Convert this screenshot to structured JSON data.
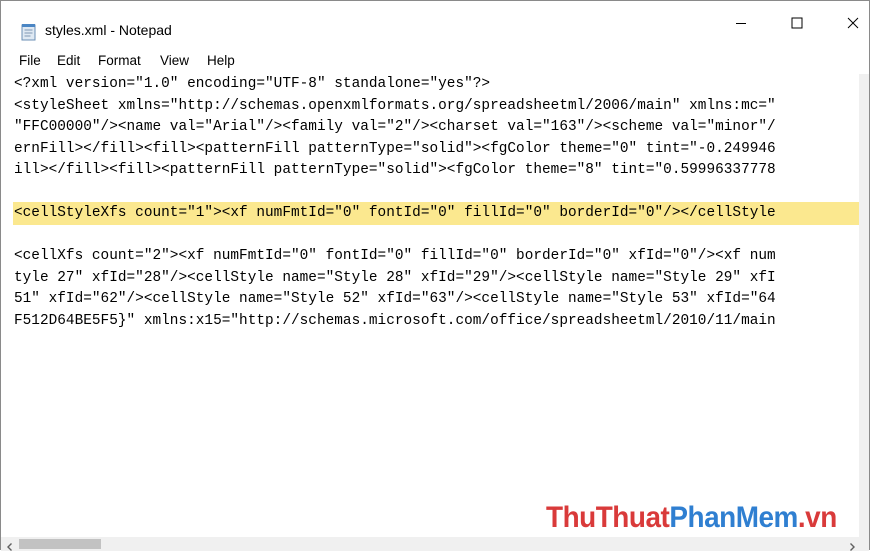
{
  "window": {
    "title": "styles.xml - Notepad",
    "icons": {
      "app": "notepad-icon",
      "minimize": "minimize-icon",
      "maximize": "maximize-icon",
      "close": "close-icon"
    }
  },
  "menu": [
    "File",
    "Edit",
    "Format",
    "View",
    "Help"
  ],
  "editor": {
    "highlight_color": "#fbe88f",
    "highlighted_line_index": 6,
    "lines": [
      "<?xml version=\"1.0\" encoding=\"UTF-8\" standalone=\"yes\"?>",
      "<styleSheet xmlns=\"http://schemas.openxmlformats.org/spreadsheetml/2006/main\" xmlns:mc=\"",
      "\"FFC00000\"/><name val=\"Arial\"/><family val=\"2\"/><charset val=\"163\"/><scheme val=\"minor\"/",
      "ernFill></fill><fill><patternFill patternType=\"solid\"><fgColor theme=\"0\" tint=\"-0.249946",
      "ill></fill><fill><patternFill patternType=\"solid\"><fgColor theme=\"8\" tint=\"0.59996337778",
      "",
      "<cellStyleXfs count=\"1\"><xf numFmtId=\"0\" fontId=\"0\" fillId=\"0\" borderId=\"0\"/></cellStyle",
      "",
      "<cellXfs count=\"2\"><xf numFmtId=\"0\" fontId=\"0\" fillId=\"0\" borderId=\"0\" xfId=\"0\"/><xf num",
      "tyle 27\" xfId=\"28\"/><cellStyle name=\"Style 28\" xfId=\"29\"/><cellStyle name=\"Style 29\" xfI",
      "51\" xfId=\"62\"/><cellStyle name=\"Style 52\" xfId=\"63\"/><cellStyle name=\"Style 53\" xfId=\"64",
      "F512D64BE5F5}\" xmlns:x15=\"http://schemas.microsoft.com/office/spreadsheetml/2010/11/main"
    ]
  },
  "watermark": {
    "part1": "ThuThuat",
    "part2": "PhanMem",
    "part3": ".vn"
  }
}
